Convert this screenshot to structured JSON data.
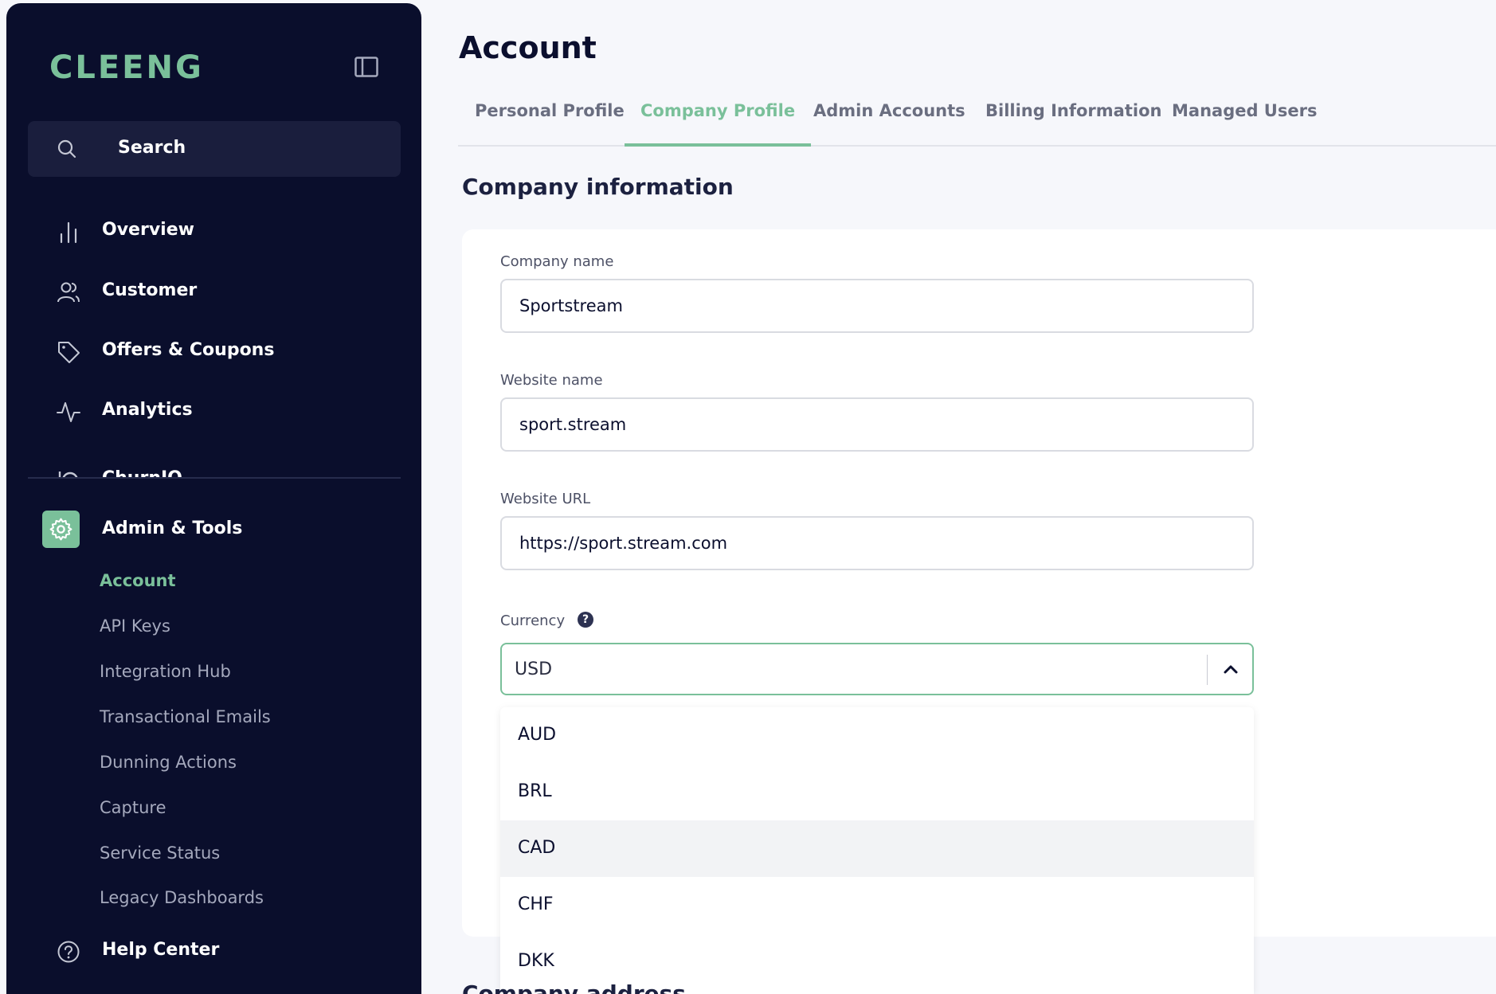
{
  "brand": {
    "logo": "CLEENG",
    "accent": "#7ac09a",
    "sidebar_bg": "#0a0e2c"
  },
  "sidebar": {
    "search_label": "Search",
    "nav": [
      {
        "label": "Overview",
        "icon": "bar-chart-icon"
      },
      {
        "label": "Customer",
        "icon": "users-icon"
      },
      {
        "label": "Offers & Coupons",
        "icon": "tag-icon"
      },
      {
        "label": "Analytics",
        "icon": "activity-icon"
      },
      {
        "label": "ChurnIQ",
        "icon": "churniq-icon"
      }
    ],
    "admin": {
      "label": "Admin & Tools",
      "icon": "gear-icon",
      "items": [
        "Account",
        "API Keys",
        "Integration Hub",
        "Transactional Emails",
        "Dunning Actions",
        "Capture",
        "Service Status",
        "Legacy Dashboards"
      ],
      "active": "Account"
    },
    "help_label": "Help Center"
  },
  "page": {
    "title": "Account",
    "tabs": [
      "Personal Profile",
      "Company Profile",
      "Admin Accounts",
      "Billing Information",
      "Managed Users"
    ],
    "active_tab": "Company Profile"
  },
  "company": {
    "section_title": "Company information",
    "company_name_label": "Company name",
    "company_name_value": "Sportstream",
    "website_name_label": "Website name",
    "website_name_value": "sport.stream",
    "website_url_label": "Website URL",
    "website_url_value": "https://sport.stream.com",
    "currency_label": "Currency",
    "currency_value": "USD",
    "currency_options": [
      "AUD",
      "BRL",
      "CAD",
      "CHF",
      "DKK"
    ],
    "hovered_option": "CAD"
  },
  "next_section_title": "Company address"
}
